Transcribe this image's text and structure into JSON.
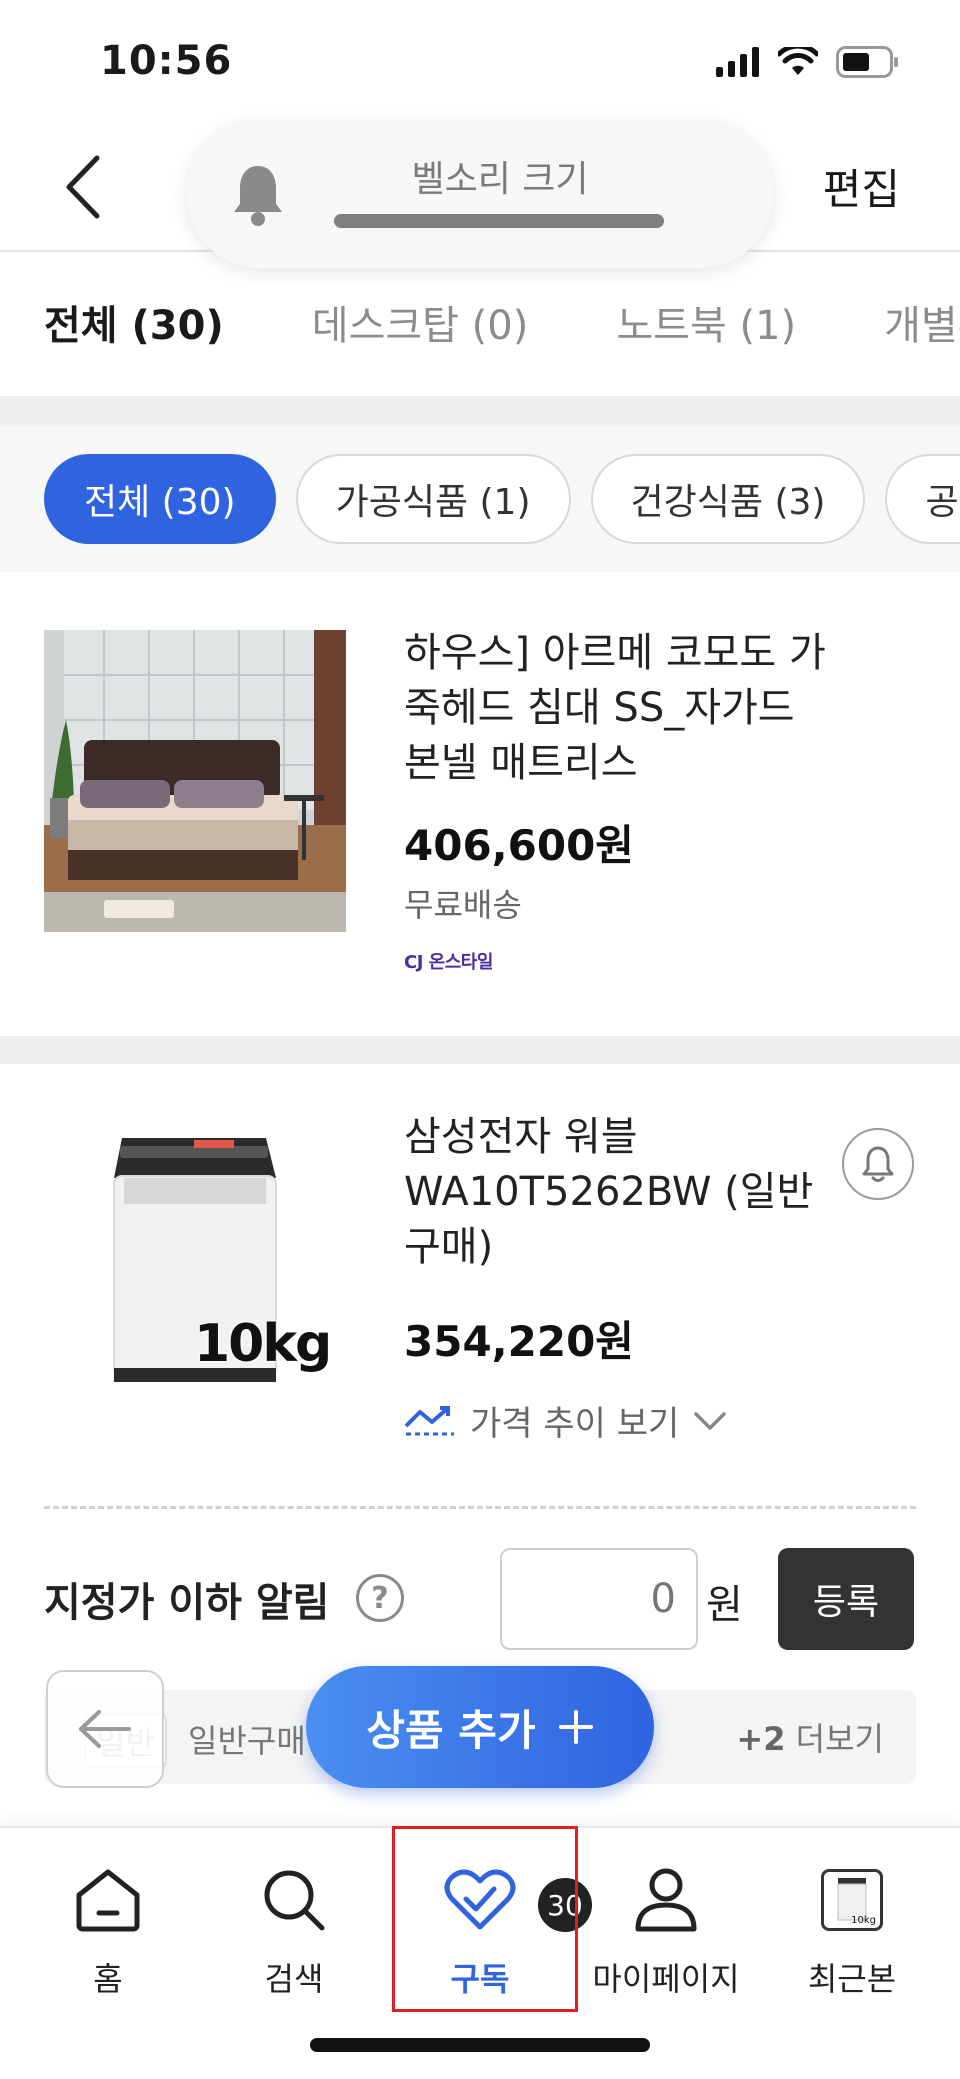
{
  "status_bar": {
    "time": "10:56"
  },
  "header": {
    "edit_label": "편집"
  },
  "volume_hud": {
    "label": "벨소리 크기",
    "level": 0.0
  },
  "category_tabs": [
    {
      "label": "전체 (30)",
      "active": true
    },
    {
      "label": "데스크탑 (0)",
      "active": false
    },
    {
      "label": "노트북 (1)",
      "active": false
    },
    {
      "label": "개별부",
      "active": false
    }
  ],
  "chips": [
    {
      "label": "전체 (30)",
      "active": true
    },
    {
      "label": "가공식품 (1)",
      "active": false
    },
    {
      "label": "건강식품 (3)",
      "active": false
    },
    {
      "label": "공유",
      "active": false
    }
  ],
  "products": [
    {
      "title": "하우스] 아르메 코모도 가죽헤드 침대 SS_자가드 본넬 매트리스",
      "price": "406,600원",
      "shipping": "무료배송",
      "seller": "CJ 온스타일"
    },
    {
      "title": "삼성전자 워블 WA10T5262BW (일반구매)",
      "price": "354,220원",
      "image_caption": "10kg",
      "price_trend_label": "가격 추이 보기",
      "alert": {
        "label": "지정가 이하 알림",
        "help": "?",
        "input_placeholder": "0",
        "unit": "원",
        "register_label": "등록"
      },
      "option": {
        "tag": "일반",
        "text": "일반구매",
        "more_count": "+2",
        "more_label": "더보기"
      }
    }
  ],
  "add_button": {
    "label": "상품 추가",
    "icon": "plus-icon"
  },
  "bottom_nav": [
    {
      "label": "홈",
      "icon": "home-icon",
      "active": false
    },
    {
      "label": "검색",
      "icon": "search-icon",
      "active": false
    },
    {
      "label": "구독",
      "icon": "heart-check-icon",
      "active": true,
      "badge": "30"
    },
    {
      "label": "마이페이지",
      "icon": "person-icon",
      "active": false
    },
    {
      "label": "최근본",
      "icon": "recent-product-icon",
      "active": false,
      "thumb_caption": "10kg"
    }
  ],
  "colors": {
    "accent": "#2f63e0",
    "highlight": "#e02020",
    "dark_button": "#333333"
  }
}
